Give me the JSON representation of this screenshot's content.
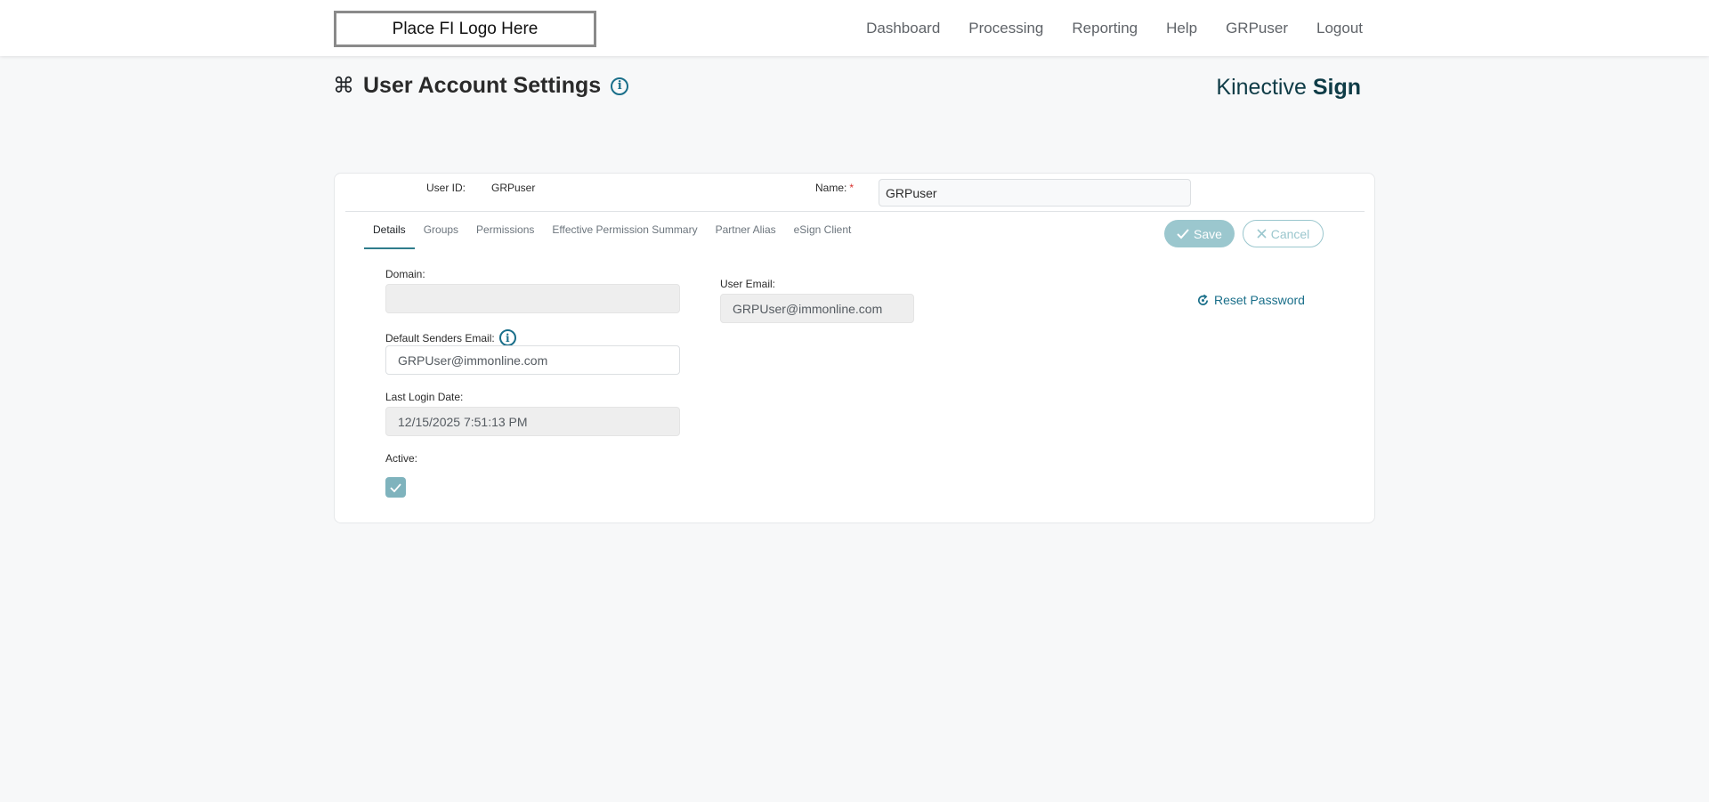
{
  "header": {
    "logo_text": "Place FI Logo Here",
    "nav": [
      "Dashboard",
      "Processing",
      "Reporting",
      "Help",
      "GRPuser",
      "Logout"
    ]
  },
  "page": {
    "title": "User Account Settings",
    "title_icon": "command-icon",
    "brand_part1": "Kinective",
    "brand_part2": "Sign"
  },
  "user": {
    "id_label": "User ID:",
    "id_value": "GRPuser",
    "name_label": "Name:",
    "name_required": "*",
    "name_value": "GRPuser"
  },
  "tabs": [
    {
      "label": "Details",
      "active": true
    },
    {
      "label": "Groups",
      "active": false
    },
    {
      "label": "Permissions",
      "active": false
    },
    {
      "label": "Effective Permission Summary",
      "active": false
    },
    {
      "label": "Partner Alias",
      "active": false
    },
    {
      "label": "eSign Client",
      "active": false
    }
  ],
  "actions": {
    "save_label": "Save",
    "cancel_label": "Cancel",
    "reset_password_label": "Reset Password"
  },
  "details": {
    "domain_label": "Domain:",
    "domain_value": "",
    "default_sender_label": "Default Senders Email:",
    "default_sender_value": "GRPUser@immonline.com",
    "last_login_label": "Last Login Date:",
    "last_login_value": "12/15/2025 7:51:13 PM",
    "active_label": "Active:",
    "active_checked": true,
    "user_email_label": "User Email:",
    "user_email_value": "GRPUser@immonline.com"
  },
  "colors": {
    "accent": "#1a6f8a",
    "save_bg": "#9bc7ce",
    "checkbox": "#7fb3bd",
    "required": "#d9302c"
  }
}
